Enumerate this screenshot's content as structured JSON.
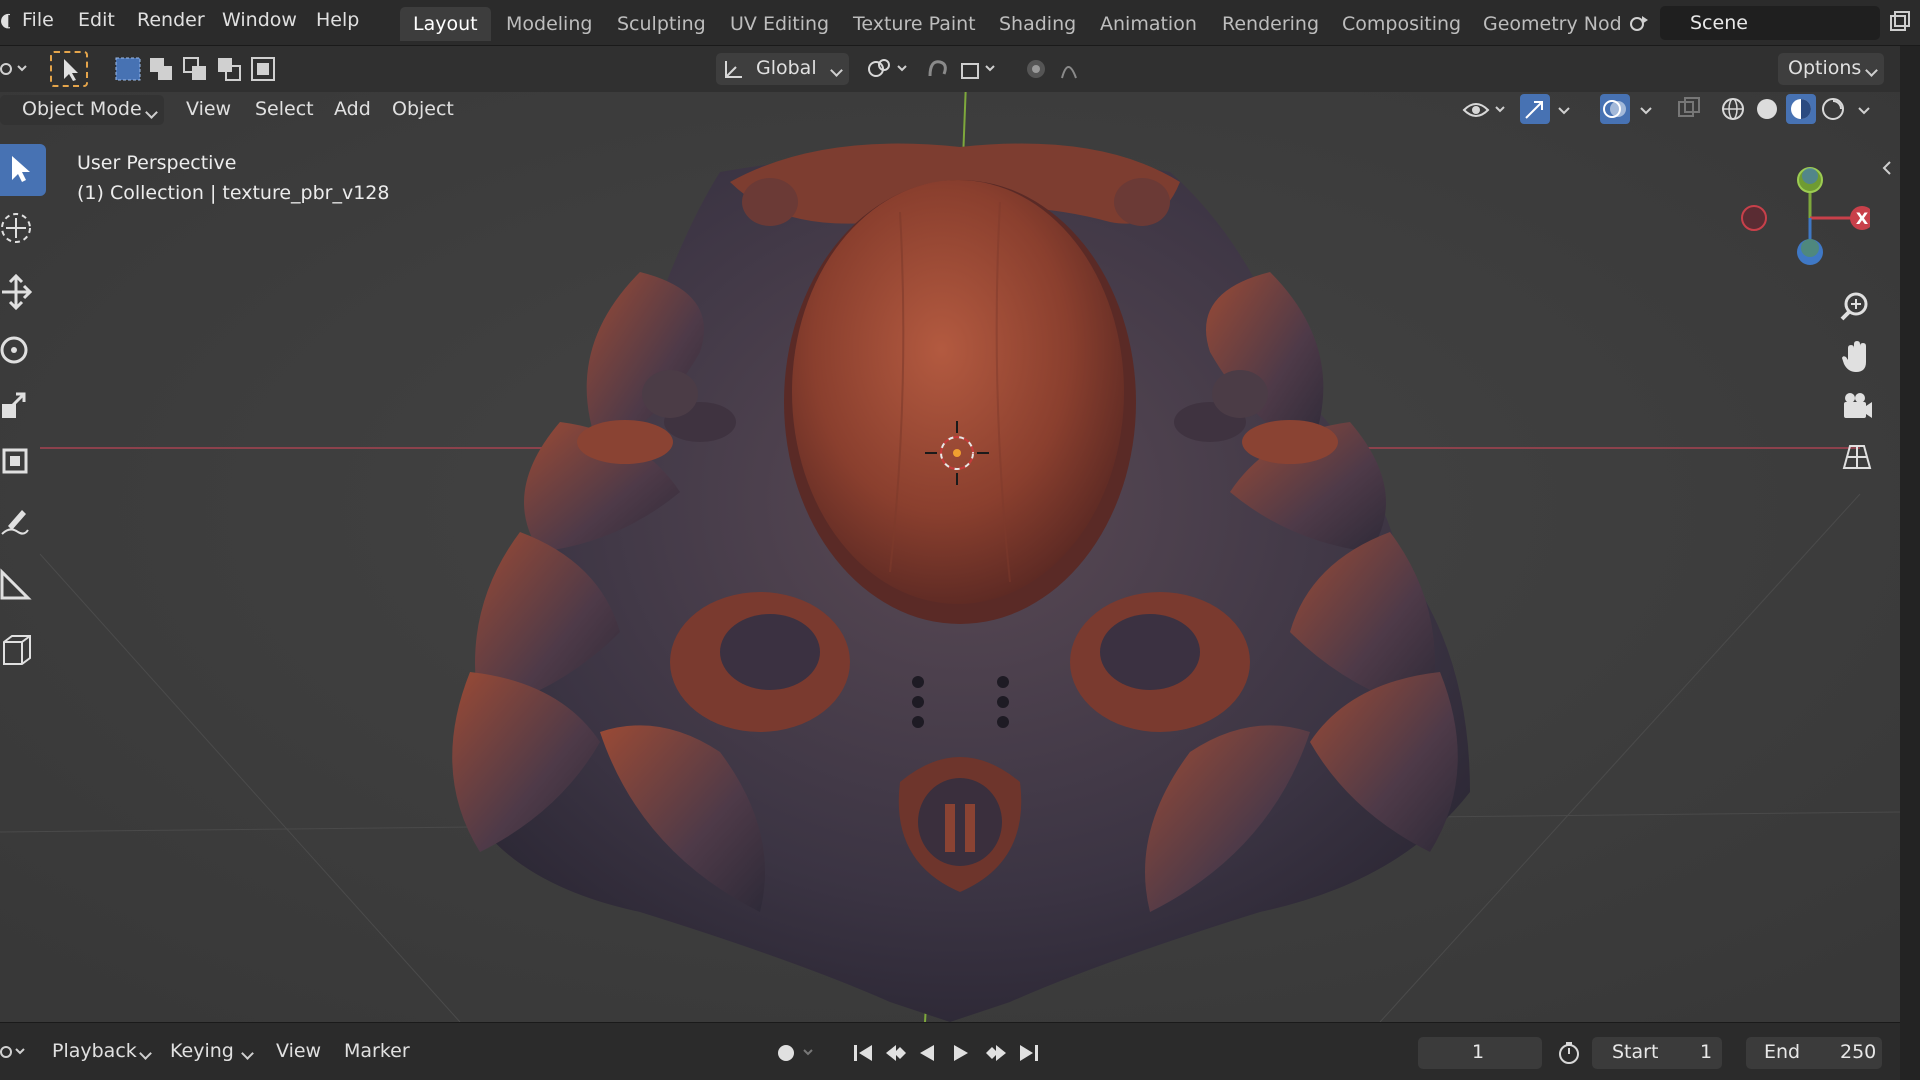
{
  "app": {
    "accent": "#4772b3",
    "axis_x_color": "#b54a55",
    "axis_y_color": "#7ea83c",
    "axis_z_color": "#3f78c5"
  },
  "menu": {
    "file": "File",
    "edit": "Edit",
    "render": "Render",
    "window": "Window",
    "help": "Help"
  },
  "workspace_tabs": [
    "Layout",
    "Modeling",
    "Sculpting",
    "UV Editing",
    "Texture Paint",
    "Shading",
    "Animation",
    "Rendering",
    "Compositing",
    "Geometry Nod"
  ],
  "active_tab": "Layout",
  "scene": {
    "name": "Scene"
  },
  "toolbar": {
    "transform_orientation": "Global",
    "options_label": "Options"
  },
  "viewport_header": {
    "mode": "Object Mode",
    "view": "View",
    "select": "Select",
    "add": "Add",
    "object": "Object"
  },
  "overlay": {
    "perspective": "User Perspective",
    "collection": "(1) Collection | texture_pbr_v128"
  },
  "gizmo": {
    "x_label": "X"
  },
  "timeline": {
    "playback": "Playback",
    "keying": "Keying",
    "view": "View",
    "marker": "Marker",
    "current_frame": "1",
    "start_label": "Start",
    "start_value": "1",
    "end_label": "End",
    "end_value": "250"
  },
  "icons": [
    "editor-type-icon",
    "select-tool-icon",
    "selection-mode-icons",
    "transform-orientation-icon",
    "pivot-icon",
    "snap-icon",
    "proportional-edit-icon",
    "visibility-icon",
    "gizmo-icon",
    "overlay-icon",
    "xray-icon",
    "shading-wireframe-icon",
    "shading-solid-icon",
    "shading-material-icon",
    "shading-rendered-icon",
    "zoom-icon",
    "pan-hand-icon",
    "camera-icon",
    "grid-ortho-icon",
    "cursor-tool-icon",
    "move-tool-icon",
    "rotate-tool-icon",
    "scale-tool-icon",
    "transform-tool-icon",
    "annotate-tool-icon",
    "measure-tool-icon",
    "add-cube-tool-icon",
    "record-icon",
    "jump-start-icon",
    "prev-keyframe-icon",
    "play-reverse-icon",
    "play-icon",
    "next-keyframe-icon",
    "jump-end-icon",
    "stopwatch-icon"
  ]
}
